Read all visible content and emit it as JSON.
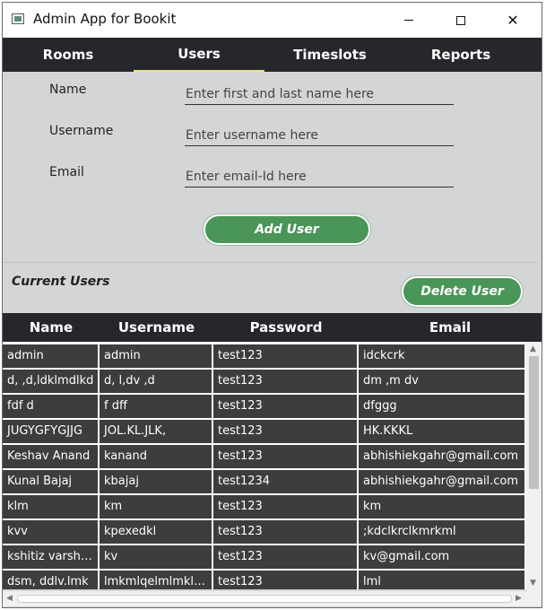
{
  "window": {
    "title": "Admin App for Bookit"
  },
  "tabs": [
    {
      "label": "Rooms",
      "active": false
    },
    {
      "label": "Users",
      "active": true
    },
    {
      "label": "Timeslots",
      "active": false
    },
    {
      "label": "Reports",
      "active": false
    }
  ],
  "form": {
    "name_label": "Name",
    "name_placeholder": "Enter first and last name here",
    "username_label": "Username",
    "username_placeholder": "Enter username here",
    "email_label": "Email",
    "email_placeholder": "Enter email-Id here",
    "add_button": "Add  User"
  },
  "users_section": {
    "title": "Current Users",
    "delete_button": "Delete User"
  },
  "table": {
    "columns": [
      "Name",
      "Username",
      "Password",
      "Email"
    ],
    "rows": [
      [
        "admin",
        "admin",
        "test123",
        "idckcrk"
      ],
      [
        "d, ,d,ldklmdlkd",
        "d, l,dv ,d",
        "test123",
        "dm ,m dv"
      ],
      [
        "fdf d",
        "f dff",
        "test123",
        "dfggg"
      ],
      [
        "JUGYGFYGJJG",
        "JOL.KL.JLK,",
        "test123",
        "HK.KKKL"
      ],
      [
        "Keshav Anand",
        "kanand",
        "test123",
        "abhishiekgahr@gmail.com"
      ],
      [
        "Kunal Bajaj",
        "kbajaj",
        "test1234",
        "abhishiekgahr@gmail.com"
      ],
      [
        "klm",
        "km",
        "test123",
        "km"
      ],
      [
        "kvv",
        "kpexedkl",
        "test123",
        ";kdclkrclkmrkml"
      ],
      [
        "kshitiz varshney",
        "kv",
        "test123",
        "kv@gmail.com"
      ],
      [
        "dsm, ddlv.lmk",
        "lmkmlqelmlmklm...",
        "test123",
        "lml"
      ]
    ]
  },
  "colors": {
    "accent_button": "#4a9558",
    "header_bg": "#25272b",
    "active_tab_underline": "#e6e38c"
  }
}
